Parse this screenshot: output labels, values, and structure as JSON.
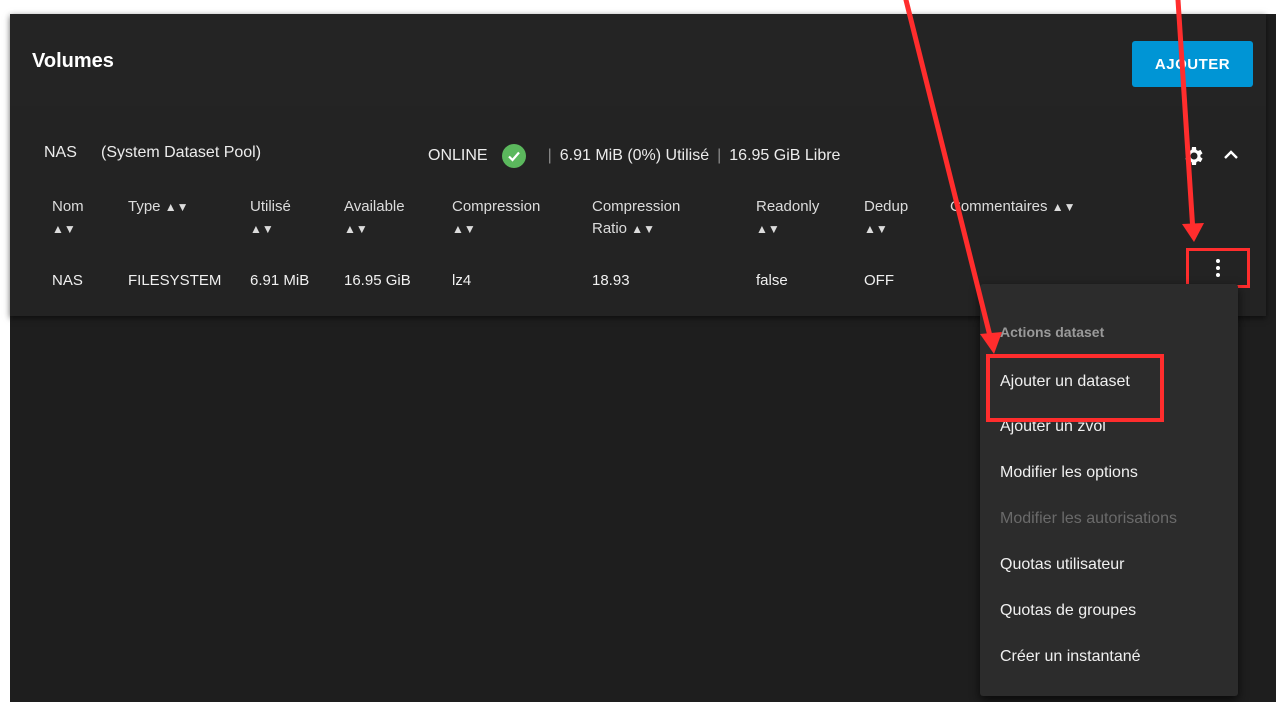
{
  "header": {
    "title": "Volumes",
    "add_label": "AJOUTER"
  },
  "pool": {
    "name": "NAS",
    "subtitle": "(System Dataset Pool)",
    "status": "ONLINE",
    "usage": "6.91 MiB (0%) Utilisé",
    "free": "16.95 GiB Libre",
    "separator": "|"
  },
  "table": {
    "sort_glyph": "▲▼",
    "columns": [
      {
        "l1": "Nom",
        "l2": ""
      },
      {
        "l1": "Type",
        "l2": ""
      },
      {
        "l1": "Utilisé",
        "l2": ""
      },
      {
        "l1": "Available",
        "l2": ""
      },
      {
        "l1": "Compression",
        "l2": ""
      },
      {
        "l1": "Compression",
        "l2": "Ratio"
      },
      {
        "l1": "Readonly",
        "l2": ""
      },
      {
        "l1": "Dedup",
        "l2": ""
      },
      {
        "l1": "Commentaires",
        "l2": ""
      }
    ],
    "rows": [
      [
        "NAS",
        "FILESYSTEM",
        "6.91 MiB",
        "16.95 GiB",
        "lz4",
        "18.93",
        "false",
        "OFF",
        ""
      ]
    ]
  },
  "menu": {
    "title": "Actions dataset",
    "items": [
      {
        "label": "Ajouter un dataset",
        "disabled": false
      },
      {
        "label": "Ajouter un zvol",
        "disabled": false
      },
      {
        "label": "Modifier les options",
        "disabled": false
      },
      {
        "label": "Modifier les autorisations",
        "disabled": true
      },
      {
        "label": "Quotas utilisateur",
        "disabled": false
      },
      {
        "label": "Quotas de groupes",
        "disabled": false
      },
      {
        "label": "Créer un instantané",
        "disabled": false
      }
    ]
  },
  "colors": {
    "accent": "#0095d5",
    "online": "#5bb85d",
    "annotation": "#ff2d2d"
  },
  "icons": [
    "check-circle-icon",
    "gear-icon",
    "chevron-up-icon",
    "kebab-menu-icon",
    "sort-icon"
  ]
}
